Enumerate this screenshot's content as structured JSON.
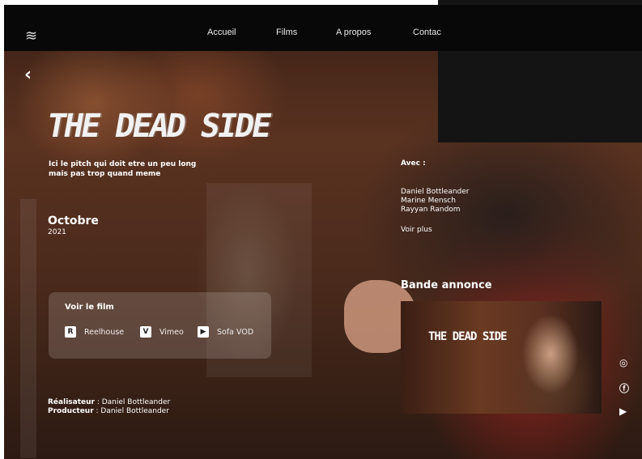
{
  "nav": {
    "logo_icon": "bird-logo-icon",
    "items": [
      "Accueil",
      "Films",
      "A propos",
      "Contac"
    ]
  },
  "film": {
    "title": "THE DEAD SIDE",
    "pitch": "Ici le pitch qui doit etre un peu long mais pas trop quand meme",
    "release_month": "Octobre",
    "release_year": "2021",
    "director_label": "Réalisateur",
    "director_name": " : Daniel Bottleander",
    "producer_label": "Producteur",
    "producer_name": " : Daniel Bottleander"
  },
  "watch": {
    "title": "Voir le film",
    "platforms": [
      {
        "name": "Reelhouse",
        "icon": "R"
      },
      {
        "name": "Vimeo",
        "icon": "V"
      },
      {
        "name": "Sofa VOD",
        "icon": "▶"
      }
    ]
  },
  "cast": {
    "label": "Avec :",
    "names": [
      "Daniel Bottleander",
      "Marine Mensch",
      "Rayyan Random"
    ],
    "see_more": "Voir plus"
  },
  "trailer": {
    "heading": "Bande annonce",
    "title": "THE DEAD SIDE"
  },
  "social": [
    "instagram-icon",
    "facebook-icon",
    "youtube-icon"
  ]
}
